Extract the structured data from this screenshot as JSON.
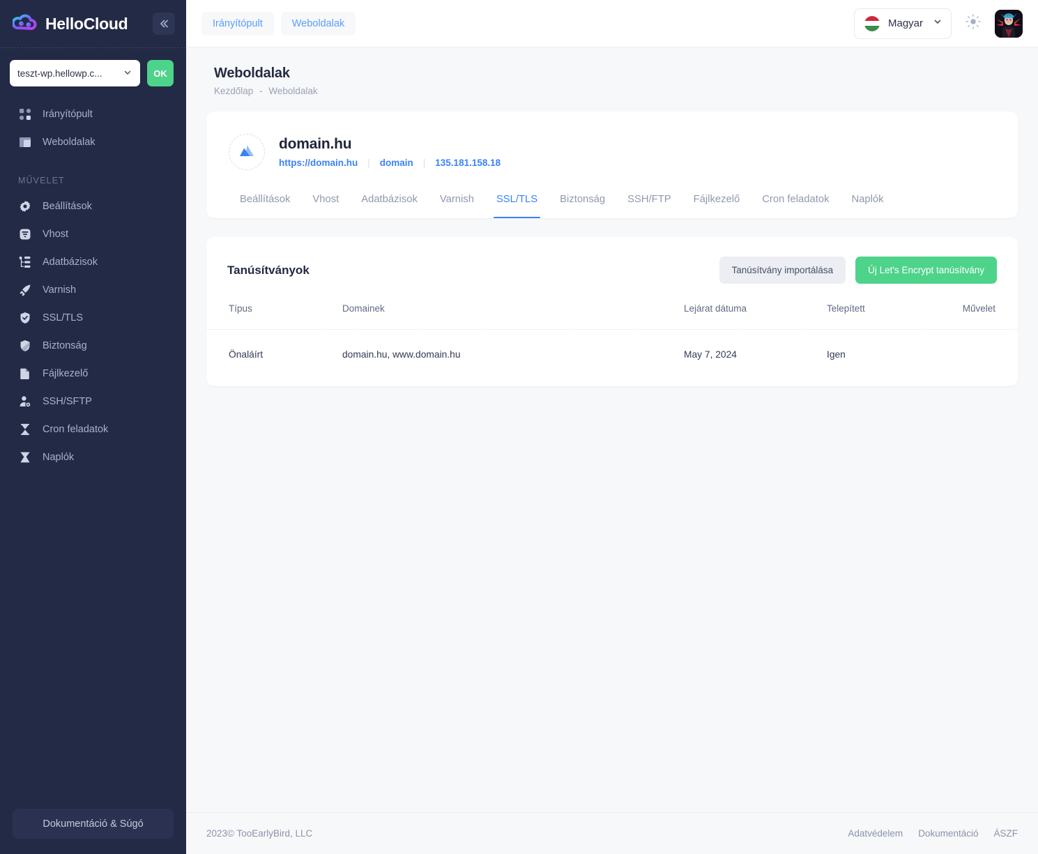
{
  "brand": {
    "name": "HelloCloud",
    "collapse_icon": "chevron-double-left-icon"
  },
  "sidebar": {
    "site_selector": {
      "value": "teszt-wp.hellowp.c...",
      "chevron": "chevron-down-icon"
    },
    "ok_label": "OK",
    "nav_top": [
      {
        "label": "Irányítópult",
        "icon": "dashboard-grid-icon"
      },
      {
        "label": "Weboldalak",
        "icon": "layout-window-icon"
      }
    ],
    "section_label": "MŰVELET",
    "nav_actions": [
      {
        "label": "Beállítások",
        "icon": "gear-icon"
      },
      {
        "label": "Vhost",
        "icon": "filter-icon"
      },
      {
        "label": "Adatbázisok",
        "icon": "database-tree-icon"
      },
      {
        "label": "Varnish",
        "icon": "rocket-icon"
      },
      {
        "label": "SSL/TLS",
        "icon": "shield-check-icon"
      },
      {
        "label": "Biztonság",
        "icon": "shield-icon"
      },
      {
        "label": "Fájlkezelő",
        "icon": "file-icon"
      },
      {
        "label": "SSH/SFTP",
        "icon": "user-key-icon"
      },
      {
        "label": "Cron feladatok",
        "icon": "hourglass-icon"
      },
      {
        "label": "Naplók",
        "icon": "logs-icon"
      }
    ],
    "doc_button": "Dokumentáció & Súgó"
  },
  "topbar": {
    "crumb_buttons": [
      {
        "label": "Irányítópult"
      },
      {
        "label": "Weboldalak"
      }
    ],
    "language": {
      "label": "Magyar",
      "flag": "hungary-flag-icon",
      "chevron": "chevron-down-icon"
    },
    "theme_toggle_icon": "sun-icon",
    "avatar": "user-avatar"
  },
  "page": {
    "title": "Weboldalak",
    "breadcrumb": {
      "home": "Kezdőlap",
      "separator": "-",
      "current": "Weboldalak"
    }
  },
  "site": {
    "avatar_icon": "mountain-icon",
    "name": "domain.hu",
    "url": "https://domain.hu",
    "user": "domain",
    "ip": "135.181.158.18",
    "tabs": [
      {
        "label": "Beállítások",
        "active": false
      },
      {
        "label": "Vhost",
        "active": false
      },
      {
        "label": "Adatbázisok",
        "active": false
      },
      {
        "label": "Varnish",
        "active": false
      },
      {
        "label": "SSL/TLS",
        "active": true
      },
      {
        "label": "Biztonság",
        "active": false
      },
      {
        "label": "SSH/FTP",
        "active": false
      },
      {
        "label": "Fájlkezelő",
        "active": false
      },
      {
        "label": "Cron feladatok",
        "active": false
      },
      {
        "label": "Naplók",
        "active": false
      }
    ]
  },
  "certificates": {
    "title": "Tanúsítványok",
    "import_button": "Tanúsítvány importálása",
    "new_button": "Új Let's Encrypt tanúsítvány",
    "columns": [
      "Típus",
      "Domainek",
      "Lejárat dátuma",
      "Telepített",
      "Művelet"
    ],
    "rows": [
      {
        "type": "Önaláírt",
        "domains": "domain.hu, www.domain.hu",
        "expiry": "May 7, 2024",
        "installed": "Igen",
        "action": ""
      }
    ]
  },
  "footer": {
    "copyright": "2023©  TooEarlyBird, LLC",
    "links": [
      "Adatvédelem",
      "Dokumentáció",
      "ÁSZF"
    ]
  },
  "colors": {
    "sidebar_bg": "#232a45",
    "accent_blue": "#3b82f6",
    "accent_green": "#4ed38a",
    "page_bg": "#f7f8fa"
  }
}
